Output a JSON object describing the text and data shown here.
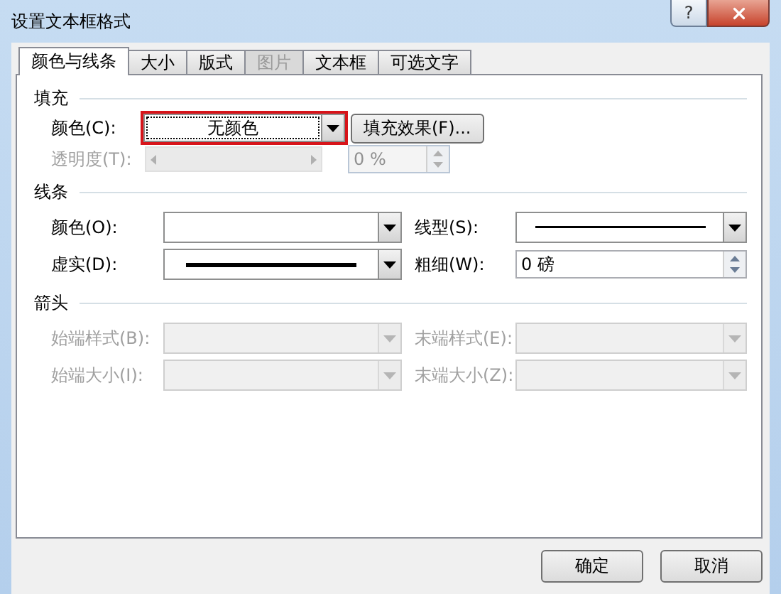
{
  "window": {
    "title": "设置文本框格式",
    "help_button": "?"
  },
  "tabs": [
    {
      "label": "颜色与线条",
      "selected": true,
      "disabled": false
    },
    {
      "label": "大小",
      "selected": false,
      "disabled": false
    },
    {
      "label": "版式",
      "selected": false,
      "disabled": false
    },
    {
      "label": "图片",
      "selected": false,
      "disabled": true
    },
    {
      "label": "文本框",
      "selected": false,
      "disabled": false
    },
    {
      "label": "可选文字",
      "selected": false,
      "disabled": false
    }
  ],
  "fill": {
    "title": "填充",
    "color": {
      "label": "颜色(C):",
      "value": "无颜色",
      "highlighted": true
    },
    "effects_button": "填充效果(F)...",
    "transparency": {
      "label": "透明度(T):",
      "disabled": true,
      "value": "0 %"
    }
  },
  "line": {
    "title": "线条",
    "fields": [
      {
        "label": "颜色(O):",
        "kind": "dropdown",
        "disabled": false
      },
      {
        "label": "线型(S):",
        "kind": "thin_line",
        "disabled": false
      },
      {
        "label": "虚实(D):",
        "kind": "thick_line",
        "disabled": false
      },
      {
        "label": "粗细(W):",
        "kind": "spin",
        "value": "0 磅",
        "disabled": false
      }
    ]
  },
  "arrows": {
    "title": "箭头",
    "fields": [
      {
        "label": "始端样式(B):",
        "kind": "dropdown",
        "disabled": true
      },
      {
        "label": "末端样式(E):",
        "kind": "dropdown",
        "disabled": true
      },
      {
        "label": "始端大小(I):",
        "kind": "dropdown",
        "disabled": true
      },
      {
        "label": "末端大小(Z):",
        "kind": "dropdown",
        "disabled": true
      }
    ]
  },
  "buttons": [
    "确定",
    "取消"
  ]
}
